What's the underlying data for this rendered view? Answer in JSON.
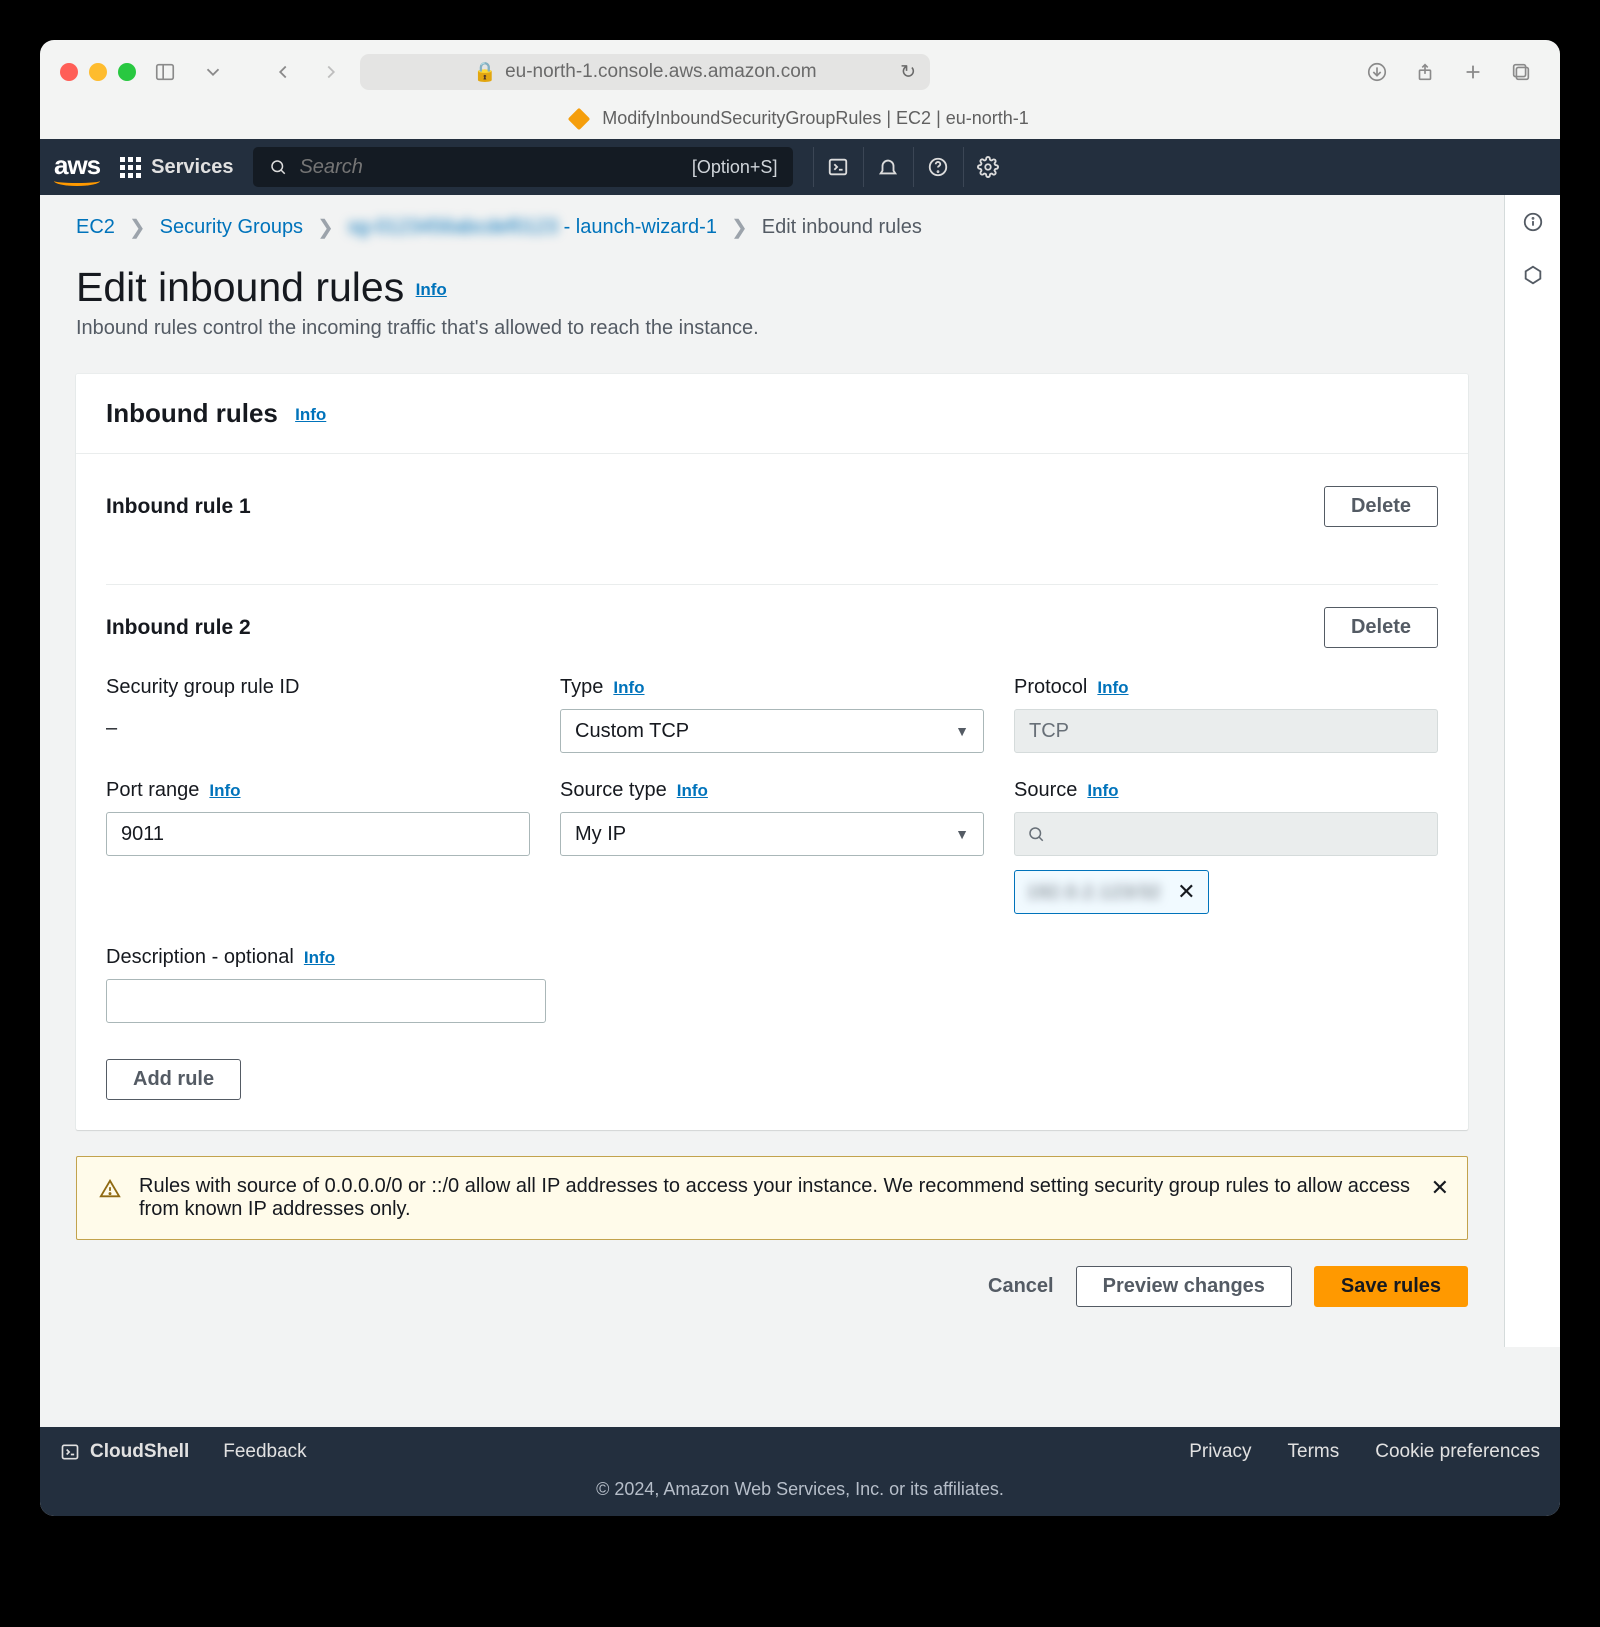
{
  "browser": {
    "address": "eu-north-1.console.aws.amazon.com",
    "tab_title": "ModifyInboundSecurityGroupRules | EC2 | eu-north-1"
  },
  "nav": {
    "logo": "aws",
    "services": "Services",
    "search_placeholder": "Search",
    "search_kbd": "[Option+S]"
  },
  "breadcrumb": {
    "ec2": "EC2",
    "sg": "Security Groups",
    "group_blur": "sg-0123456abcdef0123",
    "group_suffix": " - launch-wizard-1",
    "current": "Edit inbound rules"
  },
  "header": {
    "title": "Edit inbound rules",
    "info": "Info",
    "subtitle": "Inbound rules control the incoming traffic that's allowed to reach the instance."
  },
  "panel": {
    "title": "Inbound rules",
    "info": "Info",
    "rule1": {
      "title": "Inbound rule 1",
      "delete": "Delete"
    },
    "rule2": {
      "title": "Inbound rule 2",
      "delete": "Delete",
      "sg_rule_id_label": "Security group rule ID",
      "sg_rule_id_value": "–",
      "type_label": "Type",
      "type_value": "Custom TCP",
      "protocol_label": "Protocol",
      "protocol_value": "TCP",
      "port_label": "Port range",
      "port_value": "9011",
      "source_type_label": "Source type",
      "source_type_value": "My IP",
      "source_label": "Source",
      "source_chip_blur": "192.0.2.123/32",
      "desc_label": "Description - optional",
      "desc_value": ""
    },
    "add_rule": "Add rule",
    "info_link": "Info"
  },
  "alert": {
    "text": "Rules with source of 0.0.0.0/0 or ::/0 allow all IP addresses to access your instance. We recommend setting security group rules to allow access from known IP addresses only."
  },
  "actions": {
    "cancel": "Cancel",
    "preview": "Preview changes",
    "save": "Save rules"
  },
  "footer": {
    "cloudshell": "CloudShell",
    "feedback": "Feedback",
    "privacy": "Privacy",
    "terms": "Terms",
    "cookie": "Cookie preferences",
    "copyright": "© 2024, Amazon Web Services, Inc. or its affiliates."
  }
}
